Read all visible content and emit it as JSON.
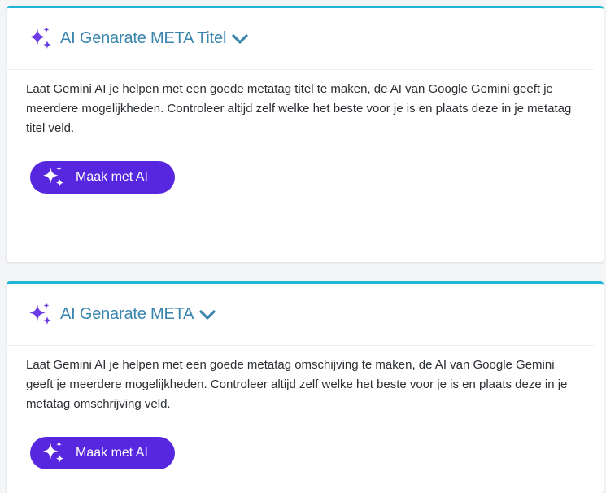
{
  "colors": {
    "accent_border": "#1fb6d5",
    "title": "#3a85ad",
    "button_bg": "#5727e0",
    "sparkle": "#6a3be6"
  },
  "cards": [
    {
      "icon": "sparkle-icon",
      "title": "AI Genarate META Titel",
      "toggle_icon": "chevron-down-icon",
      "description": "Laat Gemini AI je helpen met een goede metatag titel te maken, de AI van Google Gemini geeft je meerdere mogelijkheden. Controleer altijd zelf welke het beste voor je is en plaats deze in je metatag titel veld.",
      "button_label": "Maak met AI"
    },
    {
      "icon": "sparkle-icon",
      "title": "AI Genarate META",
      "toggle_icon": "chevron-down-icon",
      "description": "Laat Gemini AI je helpen met een goede metatag omschijving te maken, de AI van Google Gemini geeft je meerdere mogelijkheden. Controleer altijd zelf welke het beste voor je is en plaats deze in je metatag omschrijving veld.",
      "button_label": "Maak met AI"
    }
  ]
}
